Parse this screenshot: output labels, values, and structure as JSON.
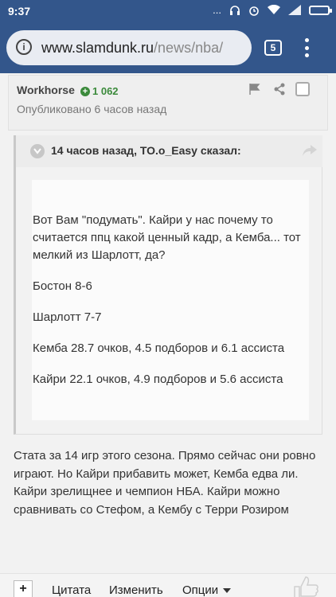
{
  "status": {
    "time": "9:37",
    "signal": "...",
    "wifi": "wifi-icon",
    "battery": "battery-icon"
  },
  "browser": {
    "url_host": "www.slamdunk.ru",
    "url_path": "/news/nba/",
    "tab_count": "5"
  },
  "post": {
    "author": "Workhorse",
    "reputation": "1 062",
    "posted": "Опубликовано 6 часов назад"
  },
  "quote": {
    "title": "14 часов назад, TO.o_Easy сказал:",
    "p1": "Вот Вам \"подумать\". Кайри у нас почему то считается ппц какой ценный кадр, а Кемба... тот мелкий из Шарлотт, да?",
    "p2": "Бостон 8-6",
    "p3": "Шарлотт 7-7",
    "p4": "Кемба 28.7 очков, 4.5 подборов и 6.1 ассиста",
    "p5": "Кайри 22.1 очков, 4.9 подборов и 5.6 ассиста"
  },
  "body_text": "Стата за 14 игр этого сезона. Прямо сейчас они ровно играют. Но Кайри прибавить может, Кемба едва ли. Кайри зрелищнее и чемпион НБА. Кайри можно сравнивать со Стефом, а Кембу с Терри Розиром",
  "toolbar": {
    "plus": "+",
    "quote_label": "Цитата",
    "edit_label": "Изменить",
    "options_label": "Опции"
  },
  "colors": {
    "brand_bar": "#33568b",
    "rep_green": "#3b8a3b"
  }
}
